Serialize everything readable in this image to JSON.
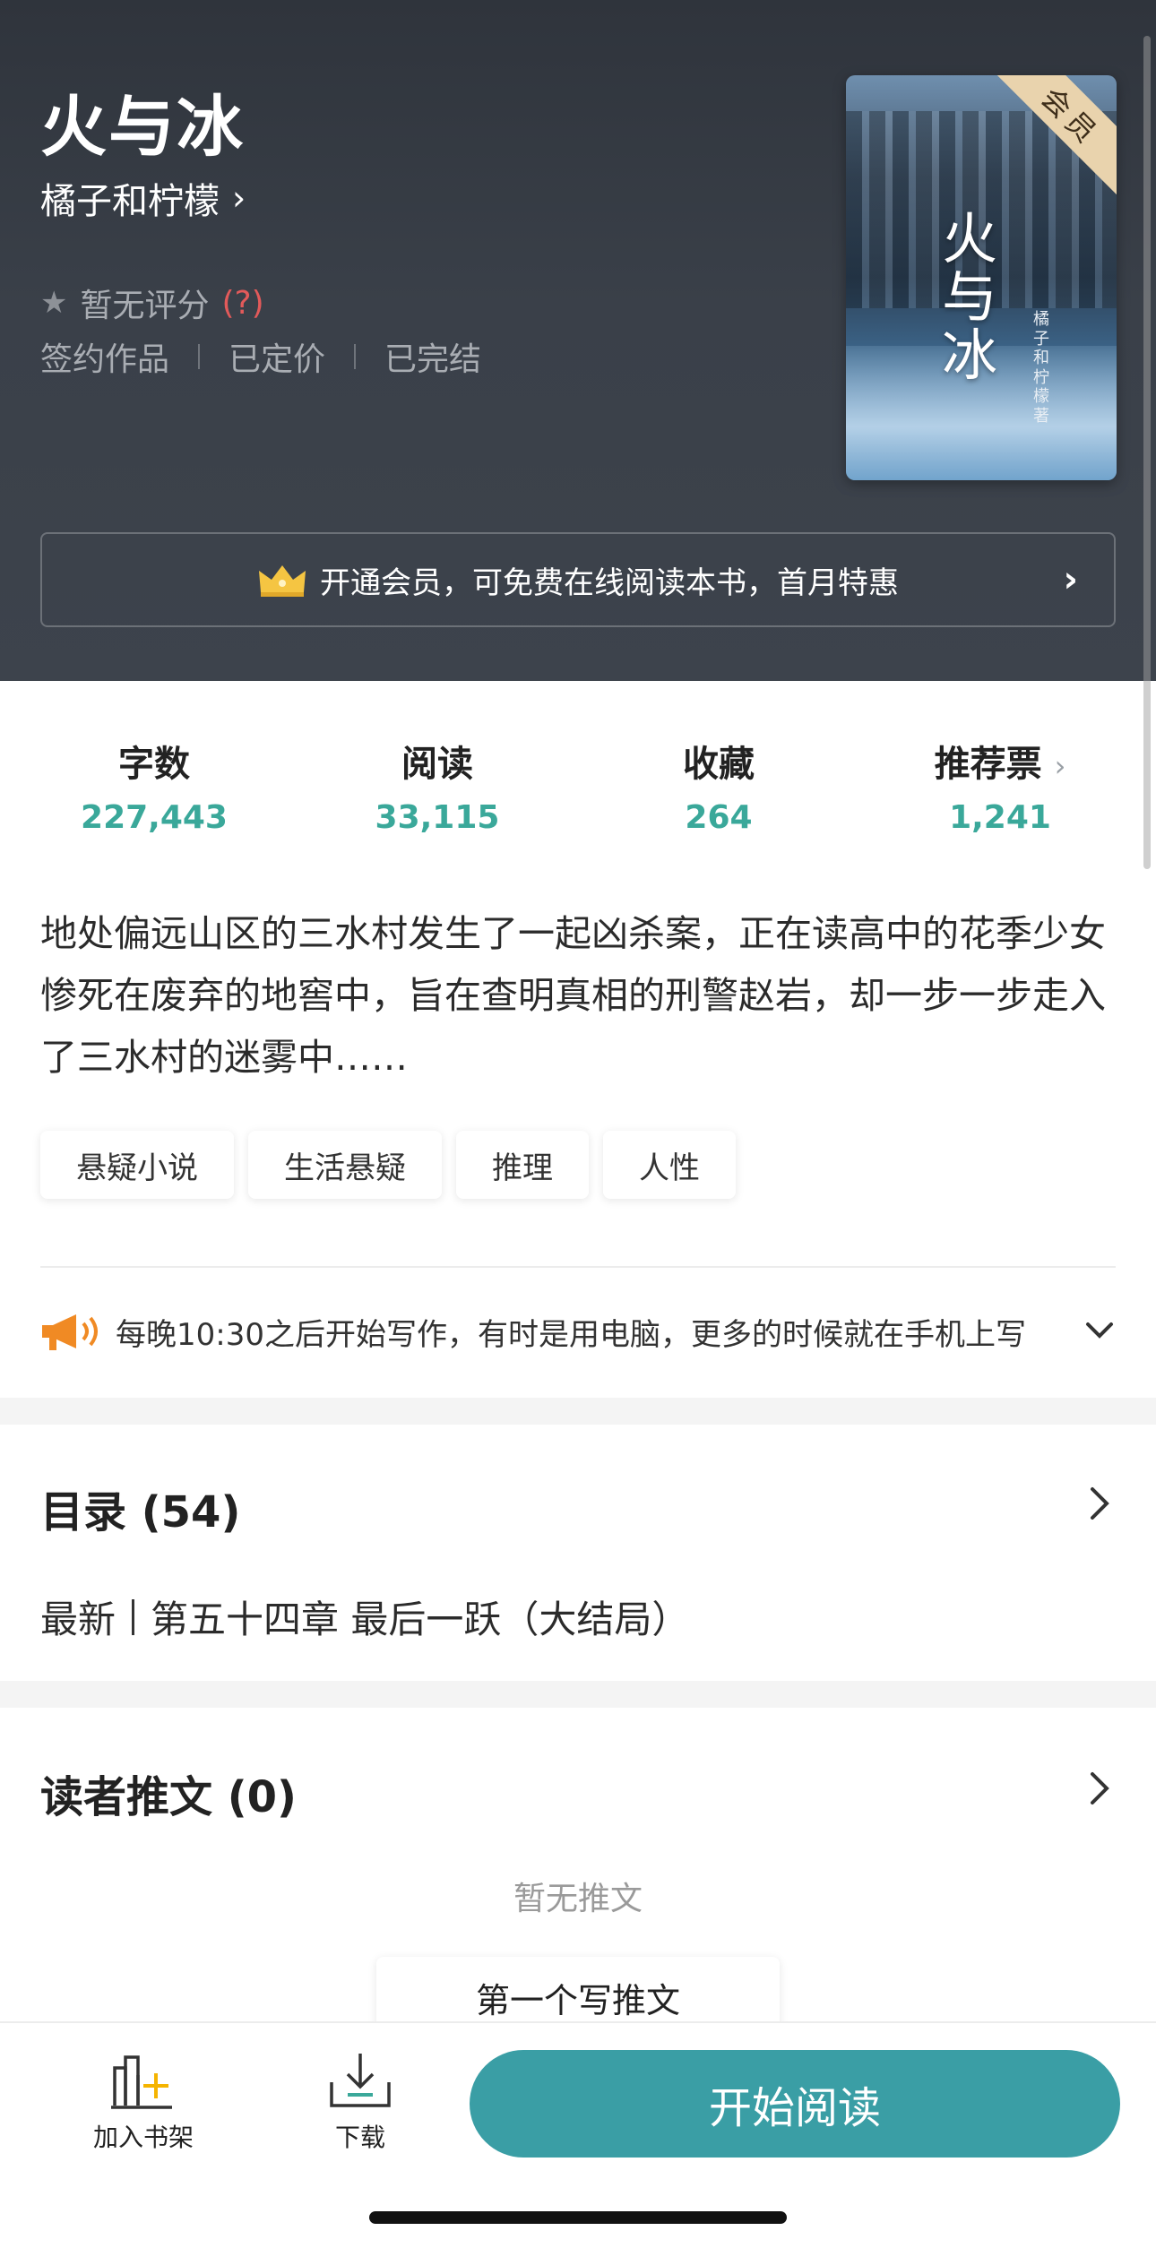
{
  "book": {
    "title": "火与冰",
    "author": "橘子和柠檬",
    "author_chevron": "›",
    "rating_text": "暂无评分",
    "rating_help": "(?)",
    "meta": [
      "签约作品",
      "已定价",
      "已完结"
    ],
    "cover": {
      "title": "火与冰",
      "author_vertical": "橘子和柠檬著",
      "corner_label": "会员"
    }
  },
  "vip_banner": {
    "text": "开通会员，可免费在线阅读本书，首月特惠",
    "arrow": "›",
    "crown_color": "#f5c542"
  },
  "stats": [
    {
      "label": "字数",
      "value": "227,443"
    },
    {
      "label": "阅读",
      "value": "33,115"
    },
    {
      "label": "收藏",
      "value": "264"
    },
    {
      "label": "推荐票",
      "value": "1,241",
      "chevron": "›"
    }
  ],
  "synopsis": "地处偏远山区的三水村发生了一起凶杀案，正在读高中的花季少女惨死在废弃的地窖中，旨在查明真相的刑警赵岩，却一步一步走入了三水村的迷雾中……",
  "tags": [
    "悬疑小说",
    "生活悬疑",
    "推理",
    "人性"
  ],
  "notice": {
    "text": "每晚10:30之后开始写作，有时是用电脑，更多的时候就在手机上写",
    "icon_color": "#f08a24"
  },
  "toc": {
    "title": "目录 (54)",
    "latest_label": "最新",
    "latest_chapter": "第五十四章  最后一跃（大结局）"
  },
  "reviews": {
    "title": "读者推文 (0)",
    "empty_text": "暂无推文",
    "write_button": "第一个写推文"
  },
  "bottom_bar": {
    "add_shelf": "加入书架",
    "download": "下载",
    "start_reading": "开始阅读"
  },
  "colors": {
    "accent": "#3aa89a",
    "button": "#3a9ea5",
    "hero_bg": "#3a4049"
  }
}
